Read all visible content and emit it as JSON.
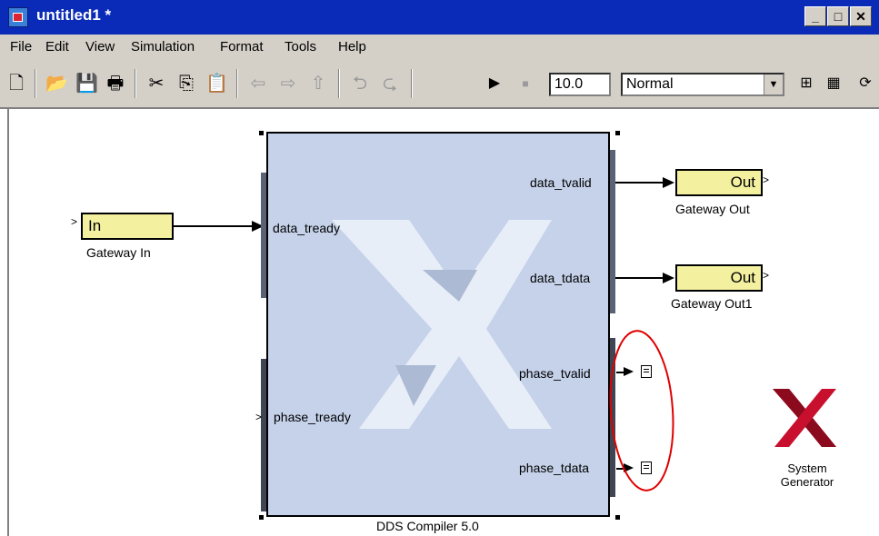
{
  "window": {
    "title": "untitled1 *"
  },
  "menu": [
    "File",
    "Edit",
    "View",
    "Simulation",
    "Format",
    "Tools",
    "Help"
  ],
  "toolbar": {
    "stop_time": "10.0",
    "sim_mode": "Normal"
  },
  "blocks": {
    "gateway_in": {
      "text": "In",
      "label": "Gateway In"
    },
    "gateway_out": {
      "text": "Out",
      "label": "Gateway Out"
    },
    "gateway_out1": {
      "text": "Out",
      "label": "Gateway Out1"
    },
    "dds": {
      "label": "DDS Compiler 5.0",
      "inputs": [
        "data_tready",
        "phase_tready"
      ],
      "outputs": [
        "data_tvalid",
        "data_tdata",
        "phase_tvalid",
        "phase_tdata"
      ]
    },
    "system_generator": {
      "line1": "System",
      "line2": "Generator"
    }
  },
  "colors": {
    "title_bar": "#0a2bb8",
    "gateway_block": "#f3f0a0",
    "dds_block": "#c5d2ea",
    "annotation": "#e00000",
    "xilinx_logo": "#c8102e"
  }
}
